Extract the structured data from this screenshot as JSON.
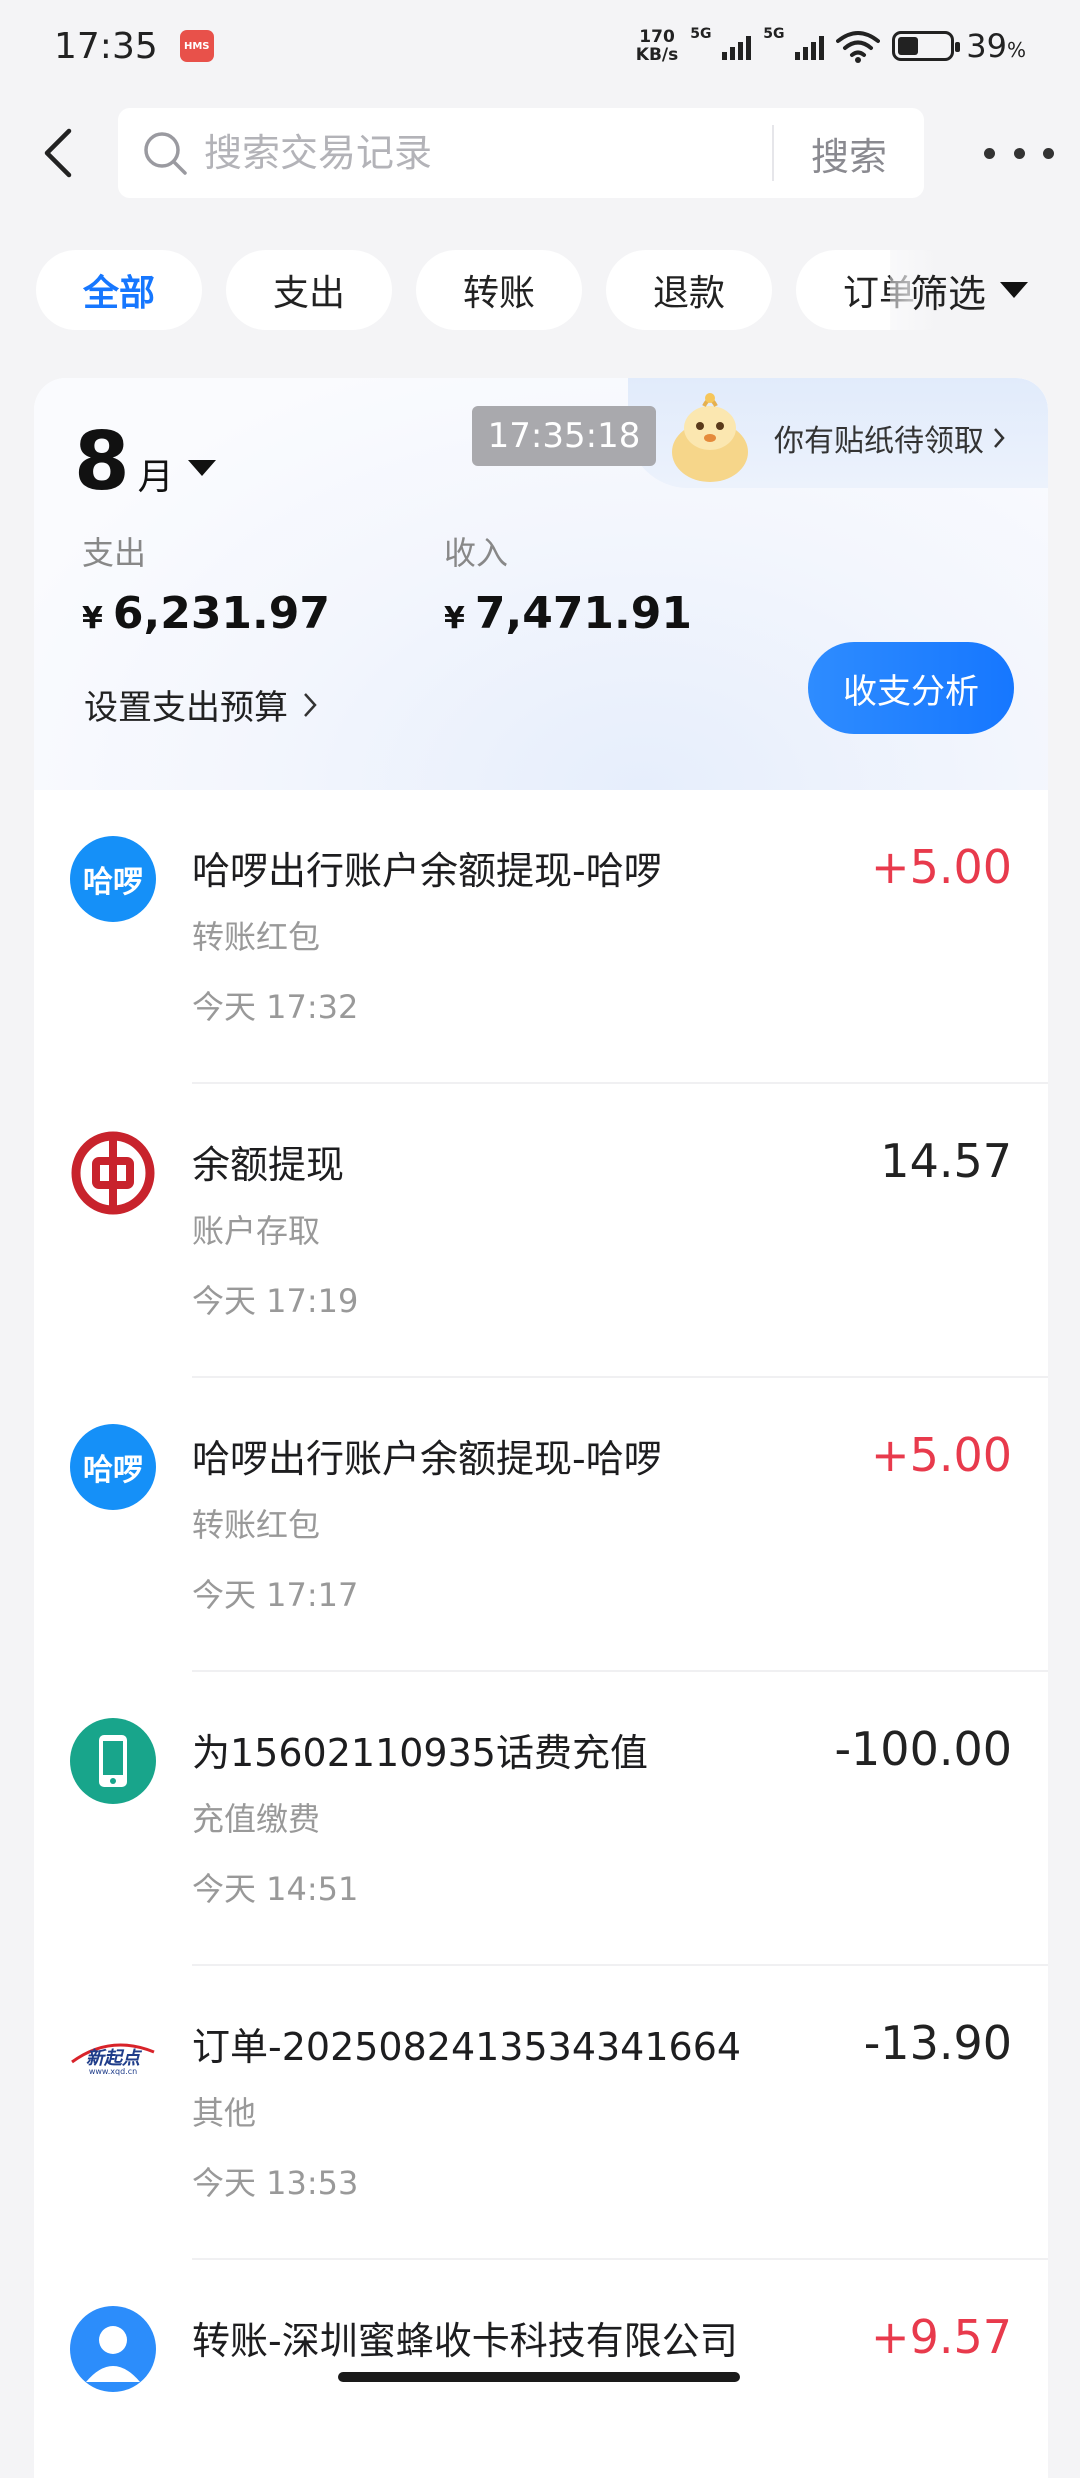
{
  "status_bar": {
    "time": "17:35",
    "hms_badge": "HMS",
    "net_speed_value": "170",
    "net_speed_unit": "KB/s",
    "signal_labels": [
      "5G",
      "5G"
    ],
    "battery_percent": "39",
    "battery_unit": "%",
    "battery_level": 0.39
  },
  "header": {
    "search_placeholder": "搜索交易记录",
    "search_button": "搜索"
  },
  "chips": [
    "全部",
    "支出",
    "转账",
    "退款",
    "订单"
  ],
  "filter_label": "筛选",
  "summary": {
    "timestamp": "17:35:18",
    "sticker_text": "你有贴纸待领取",
    "month": "8",
    "month_unit": "月",
    "expense_label": "支出",
    "expense_currency": "¥",
    "expense_amount": "6,231.97",
    "income_label": "收入",
    "income_currency": "¥",
    "income_amount": "7,471.91",
    "budget_link": "设置支出预算",
    "analysis_button": "收支分析"
  },
  "transactions": [
    {
      "icon": "hello-logo-icon",
      "icon_text": "哈啰",
      "title": "哈啰出行账户余额提现-哈啰",
      "category": "转账红包",
      "time": "今天 17:32",
      "amount": "+5.00",
      "positive": true
    },
    {
      "icon": "bank-of-china-icon",
      "icon_text": "",
      "title": "余额提现",
      "category": "账户存取",
      "time": "今天 17:19",
      "amount": "14.57",
      "positive": false
    },
    {
      "icon": "hello-logo-icon",
      "icon_text": "哈啰",
      "title": "哈啰出行账户余额提现-哈啰",
      "category": "转账红包",
      "time": "今天 17:17",
      "amount": "+5.00",
      "positive": true
    },
    {
      "icon": "phone-icon",
      "icon_text": "",
      "title": "为15602110935话费充值",
      "category": "充值缴费",
      "time": "今天 14:51",
      "amount": "-100.00",
      "positive": false
    },
    {
      "icon": "xinqidian-logo-icon",
      "icon_text": "新起点",
      "icon_subtext": "www.xqd.cn",
      "title": "订单-2025082413534341664",
      "category": "其他",
      "time": "今天 13:53",
      "amount": "-13.90",
      "positive": false
    },
    {
      "icon": "user-avatar-icon",
      "icon_text": "",
      "title": "转账-深圳蜜蜂收卡科技有限公司",
      "category": "",
      "time": "",
      "amount": "+9.57",
      "positive": true
    }
  ],
  "colors": {
    "accent": "#1677ff",
    "positive_amount": "#e83a4c",
    "bank_red": "#c8232c",
    "phone_green": "#18a58b"
  }
}
